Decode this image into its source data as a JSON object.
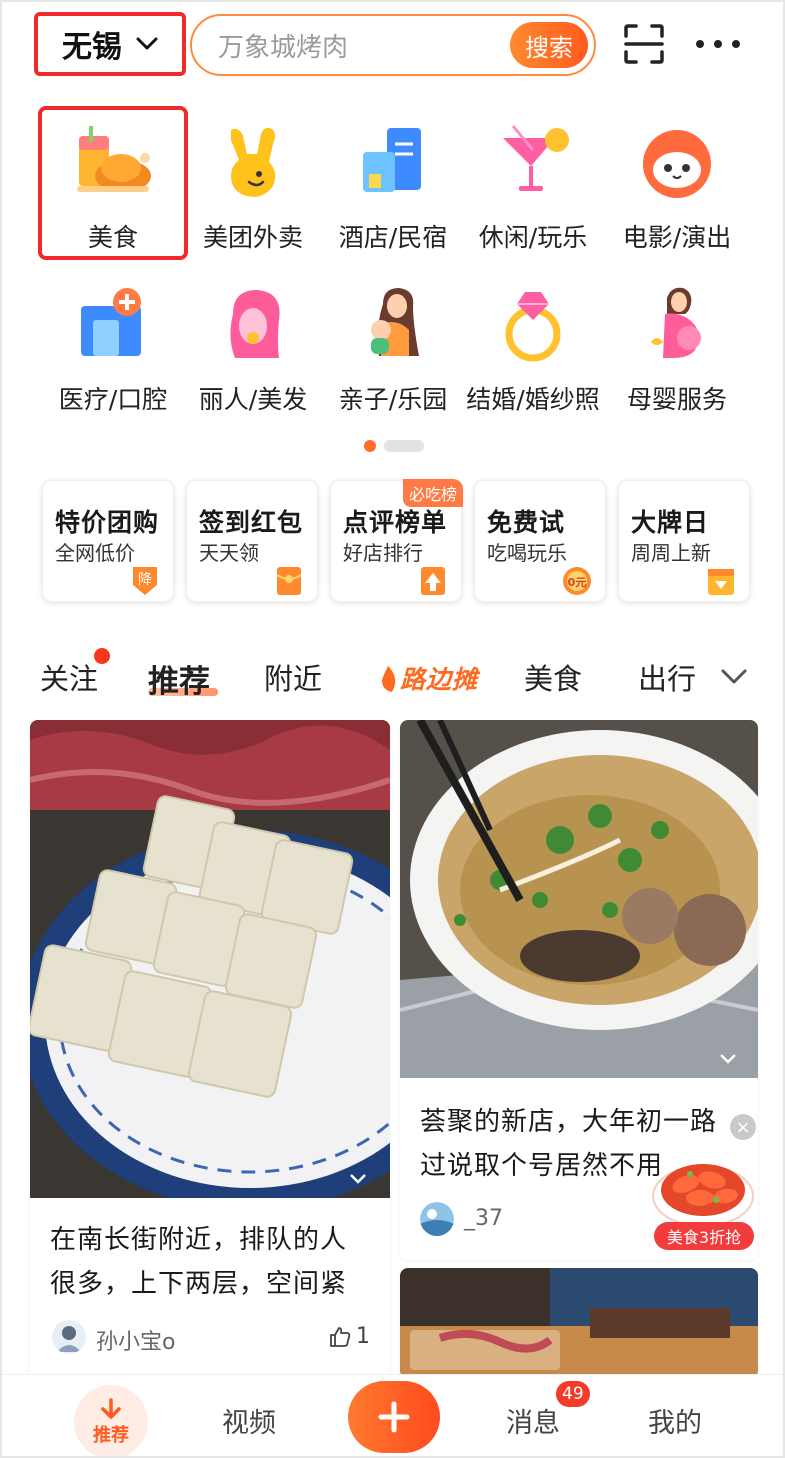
{
  "header": {
    "city": "无锡",
    "search_placeholder": "万象城烤肉",
    "search_button": "搜索"
  },
  "categories": [
    {
      "label": "美食",
      "icon": "food-icon"
    },
    {
      "label": "美团外卖",
      "icon": "delivery-icon"
    },
    {
      "label": "酒店/民宿",
      "icon": "hotel-icon"
    },
    {
      "label": "休闲/玩乐",
      "icon": "cocktail-icon"
    },
    {
      "label": "电影/演出",
      "icon": "movie-icon"
    },
    {
      "label": "医疗/口腔",
      "icon": "medical-icon"
    },
    {
      "label": "丽人/美发",
      "icon": "beauty-icon"
    },
    {
      "label": "亲子/乐园",
      "icon": "family-icon"
    },
    {
      "label": "结婚/婚纱照",
      "icon": "ring-icon"
    },
    {
      "label": "母婴服务",
      "icon": "maternity-icon"
    }
  ],
  "promos": [
    {
      "title": "特价团购",
      "subtitle": "全网低价",
      "icon_text": "降",
      "badge": ""
    },
    {
      "title": "签到红包",
      "subtitle": "天天领",
      "icon_text": "",
      "badge": ""
    },
    {
      "title": "点评榜单",
      "subtitle": "好店排行",
      "icon_text": "",
      "badge": "必吃榜"
    },
    {
      "title": "免费试",
      "subtitle": "吃喝玩乐",
      "icon_text": "0元",
      "badge": ""
    },
    {
      "title": "大牌日",
      "subtitle": "周周上新",
      "icon_text": "",
      "badge": ""
    }
  ],
  "tabs": [
    "关注",
    "推荐",
    "附近",
    "路边摊",
    "美食",
    "出行"
  ],
  "active_tab": "推荐",
  "feed": {
    "left": {
      "title_line1": "在南长街附近，排队的人",
      "title_line2": "很多，上下两层，空间紧",
      "author": "孙小宝o",
      "likes": "1"
    },
    "right": {
      "title_line1": "荟聚的新店，大年初一路",
      "title_line2": "过说取个号居然不用",
      "author": "_37"
    },
    "float_promo": "美食3折抢",
    "float_close": "×"
  },
  "bottom_nav": {
    "home": "推荐",
    "video": "视频",
    "messages": "消息",
    "messages_badge": "49",
    "mine": "我的"
  },
  "colors": {
    "accent": "#ff5a1f",
    "highlight_box": "#f2292b",
    "badge_red": "#f23b2b"
  }
}
